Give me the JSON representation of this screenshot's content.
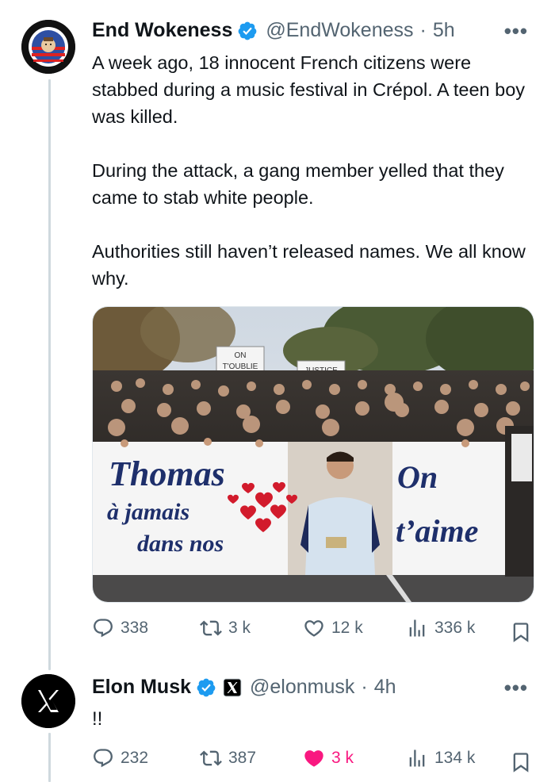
{
  "tweet1": {
    "display_name": "End Wokeness",
    "handle": "@EndWokeness",
    "separator": "·",
    "time": "5h",
    "avatar_text_top": "I SUPPORT THE",
    "avatar_text_bottom": "FORMER THINGS",
    "paragraphs": [
      "A week ago, 18 innocent French citizens were stabbed during a music festival in Crépol. A teen boy was killed.",
      "During the attack, a gang member yelled that they came to stab white people.",
      "Authorities still haven’t released names. We all know why."
    ],
    "photo": {
      "sign_text": "ON TOUBLIE PAS",
      "sign2_text": "JUSTICE",
      "banner_line1": "Thomas",
      "banner_line2": "à jamais",
      "banner_line3": "dans nos",
      "banner_right1": "On",
      "banner_right2": "t’aime"
    },
    "stats": {
      "replies": "338",
      "reposts": "3 k",
      "likes": "12 k",
      "views": "336 k"
    }
  },
  "tweet2": {
    "display_name": "Elon Musk",
    "handle": "@elonmusk",
    "separator": "·",
    "time": "4h",
    "text": "!!",
    "stats": {
      "replies": "232",
      "reposts": "387",
      "likes": "3 k",
      "views": "134 k"
    }
  },
  "colors": {
    "text": "#0f1419",
    "muted": "#536471",
    "verified": "#1d9bf0",
    "like_active": "#f91880",
    "thread_line": "#cfd9de"
  },
  "icons": [
    "reply-icon",
    "repost-icon",
    "like-icon",
    "views-icon",
    "bookmark-icon",
    "verified-badge-icon",
    "more-icon",
    "x-logo-icon",
    "x-affiliate-badge-icon"
  ]
}
